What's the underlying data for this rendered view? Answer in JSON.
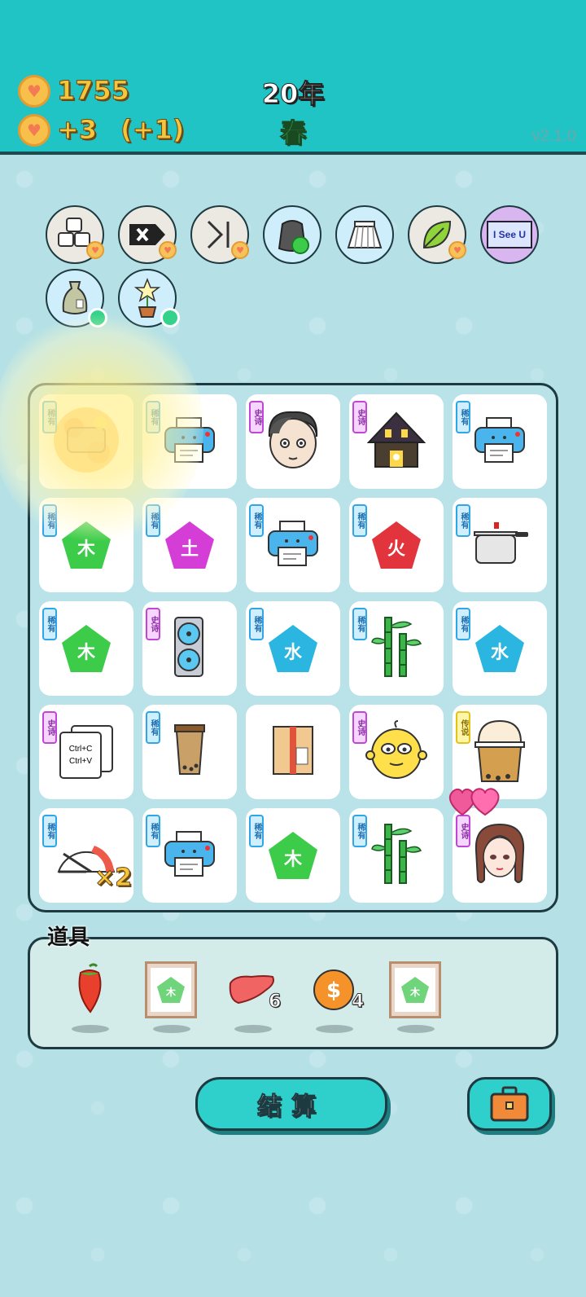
{
  "header": {
    "coins": "1755",
    "income": "+3",
    "bonus": "(+1)",
    "year": "20年",
    "season": "春",
    "version": "v2.1.0"
  },
  "relics": [
    {
      "name": "sugar-cubes",
      "bg": "#ece9e2",
      "badge": "heart"
    },
    {
      "name": "delete-tag",
      "bg": "#ece9e2",
      "badge": "heart"
    },
    {
      "name": "skip",
      "bg": "#ece9e2",
      "badge": "heart"
    },
    {
      "name": "recycle-bag",
      "bg": "#cfeefc",
      "badge": "none"
    },
    {
      "name": "skirt",
      "bg": "#cfeefc",
      "badge": "none"
    },
    {
      "name": "leaf",
      "bg": "#ece9e2",
      "badge": "heart"
    },
    {
      "name": "i-see-u",
      "bg": "#dab6f0",
      "badge": "none",
      "label": "I See U"
    },
    {
      "name": "sack",
      "bg": "#cfeefc",
      "badge": "green"
    },
    {
      "name": "star-plant",
      "bg": "#cfeefc",
      "badge": "green"
    }
  ],
  "board": {
    "rows": [
      [
        {
          "rarity": "稀有",
          "tier": "rare",
          "item": "pressure-cooker-burst"
        },
        {
          "rarity": "稀有",
          "tier": "rare",
          "item": "printer"
        },
        {
          "rarity": "史诗",
          "tier": "epic",
          "item": "man-face"
        },
        {
          "rarity": "史诗",
          "tier": "epic",
          "item": "haunted-house"
        },
        {
          "rarity": "稀有",
          "tier": "rare",
          "item": "printer"
        }
      ],
      [
        {
          "rarity": "稀有",
          "tier": "rare",
          "item": "wood-gem",
          "glyph": "木",
          "color": "#3ccc4a"
        },
        {
          "rarity": "稀有",
          "tier": "rare",
          "item": "earth-gem",
          "glyph": "土",
          "color": "#d43ed6"
        },
        {
          "rarity": "稀有",
          "tier": "rare",
          "item": "printer"
        },
        {
          "rarity": "稀有",
          "tier": "rare",
          "item": "fire-gem",
          "glyph": "火",
          "color": "#e2343c"
        },
        {
          "rarity": "稀有",
          "tier": "rare",
          "item": "pressure-cooker"
        }
      ],
      [
        {
          "rarity": "稀有",
          "tier": "rare",
          "item": "wood-gem",
          "glyph": "木",
          "color": "#3ccc4a"
        },
        {
          "rarity": "史诗",
          "tier": "epic",
          "item": "graphics-card"
        },
        {
          "rarity": "稀有",
          "tier": "rare",
          "item": "water-gem",
          "glyph": "水",
          "color": "#2ab6e0"
        },
        {
          "rarity": "稀有",
          "tier": "rare",
          "item": "bamboo"
        },
        {
          "rarity": "稀有",
          "tier": "rare",
          "item": "water-gem",
          "glyph": "水",
          "color": "#2ab6e0"
        }
      ],
      [
        {
          "rarity": "史诗",
          "tier": "epic",
          "item": "copy-paste",
          "text1": "Ctrl+C",
          "text2": "Ctrl+V"
        },
        {
          "rarity": "稀有",
          "tier": "rare",
          "item": "bubble-tea-cup"
        },
        {
          "rarity": "",
          "tier": "",
          "item": "parcel-box"
        },
        {
          "rarity": "史诗",
          "tier": "epic",
          "item": "yellow-face"
        },
        {
          "rarity": "传说",
          "tier": "legend",
          "item": "big-bubble-tea"
        }
      ],
      [
        {
          "rarity": "稀有",
          "tier": "rare",
          "item": "speed-gauge"
        },
        {
          "rarity": "稀有",
          "tier": "rare",
          "item": "printer"
        },
        {
          "rarity": "稀有",
          "tier": "rare",
          "item": "wood-gem",
          "glyph": "木",
          "color": "#3ccc4a"
        },
        {
          "rarity": "稀有",
          "tier": "rare",
          "item": "bamboo"
        },
        {
          "rarity": "史诗",
          "tier": "epic",
          "item": "girl-face"
        }
      ]
    ],
    "multiplier": "×2"
  },
  "items": {
    "title": "道具",
    "list": [
      {
        "name": "chili-pepper",
        "count": ""
      },
      {
        "name": "wood-gem-frame",
        "glyph": "木",
        "count": ""
      },
      {
        "name": "liver",
        "count": "6"
      },
      {
        "name": "dollar-coin",
        "count": "4"
      },
      {
        "name": "wood-gem-frame",
        "glyph": "木",
        "count": ""
      }
    ]
  },
  "buttons": {
    "settle": "结算"
  },
  "colors": {
    "header": "#21c4c5",
    "background": "#b4e0e6",
    "coin_text": "#f5c53c",
    "season_text": "#3fd364"
  }
}
